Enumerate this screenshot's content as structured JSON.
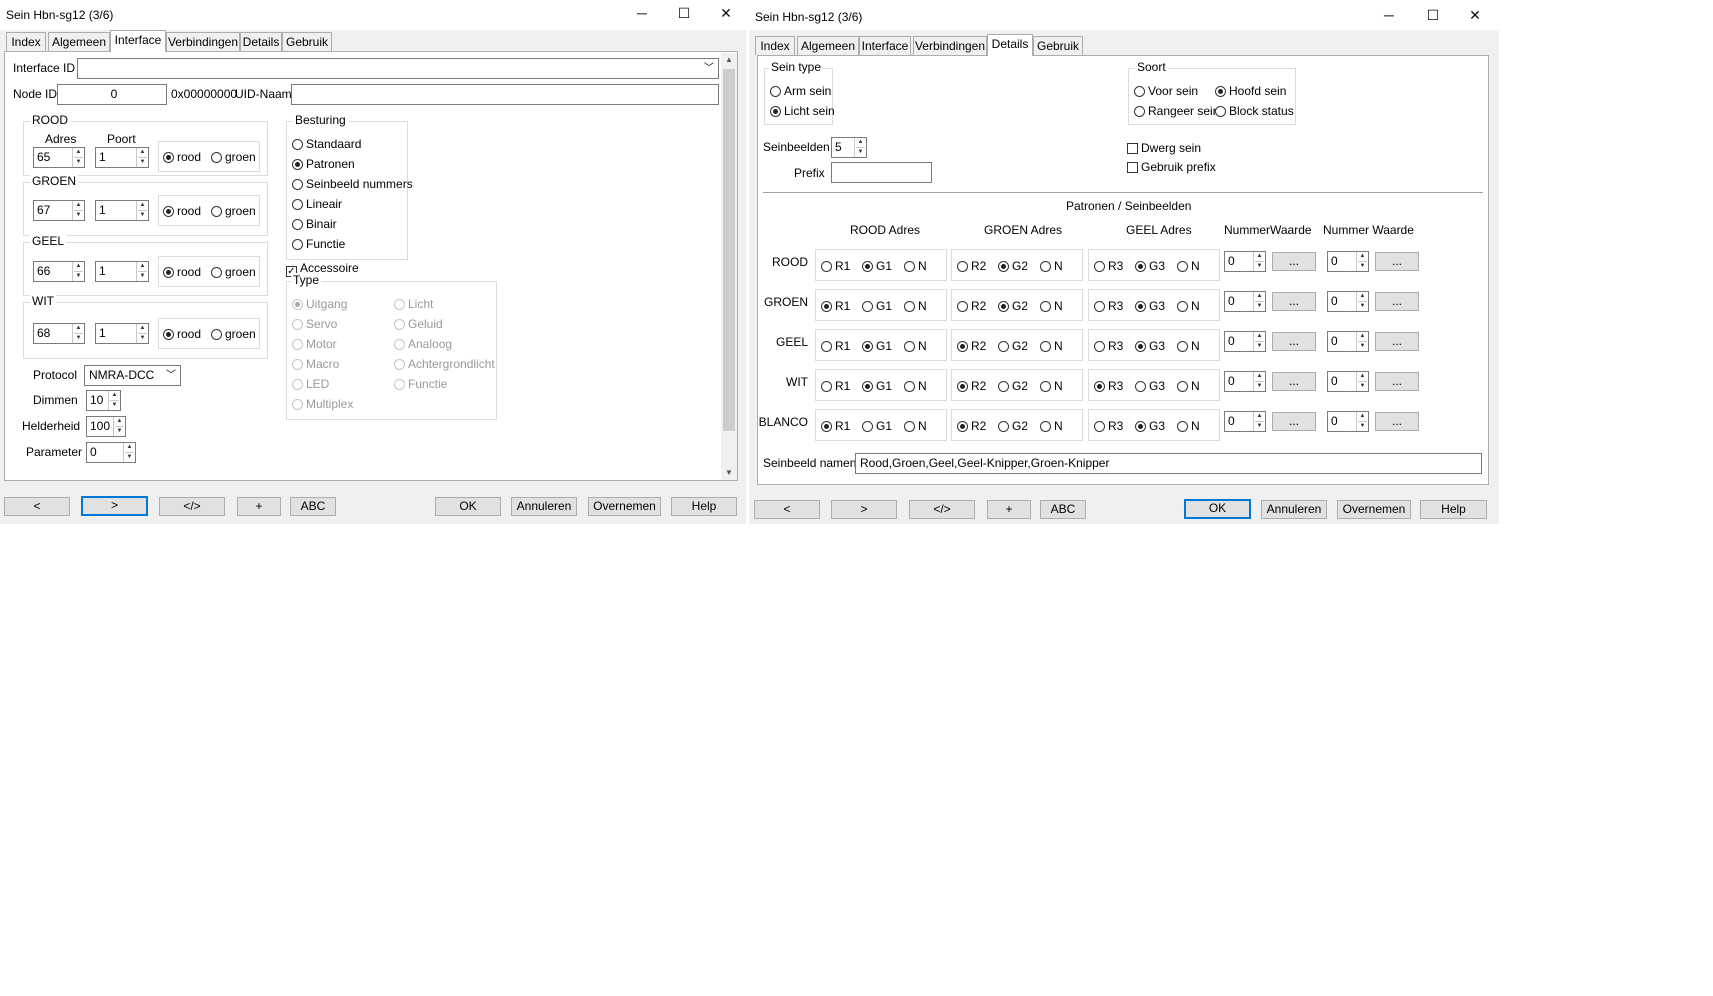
{
  "left": {
    "title": "Sein Hbn-sg12 (3/6)",
    "tabs": [
      "Index",
      "Algemeen",
      "Interface",
      "Verbindingen",
      "Details",
      "Gebruik"
    ],
    "interface_id_label": "Interface ID",
    "interface_id_value": "",
    "node_id_label": "Node ID",
    "node_id_value": "0",
    "hex_value": "0x00000000",
    "uid_label": "UID-Naam",
    "uid_value": "",
    "adres_label": "Adres",
    "poort_label": "Poort",
    "rood_option": "rood",
    "groen_option": "groen",
    "colors": [
      {
        "name": "ROOD",
        "adres": "65",
        "poort": "1"
      },
      {
        "name": "GROEN",
        "adres": "67",
        "poort": "1"
      },
      {
        "name": "GEEL",
        "adres": "66",
        "poort": "1"
      },
      {
        "name": "WIT",
        "adres": "68",
        "poort": "1"
      }
    ],
    "besturing_title": "Besturing",
    "besturing": [
      "Standaard",
      "Patronen",
      "Seinbeeld nummers",
      "Lineair",
      "Binair",
      "Functie"
    ],
    "besturing_selected": "Patronen",
    "accessoire_label": "Accessoire",
    "accessoire_checked": true,
    "type_title": "Type",
    "type_col1": [
      "Uitgang",
      "Servo",
      "Motor",
      "Macro",
      "LED",
      "Multiplex"
    ],
    "type_col2": [
      "Licht",
      "Geluid",
      "Analoog",
      "Achtergrondlicht",
      "Functie"
    ],
    "type_selected": "Uitgang",
    "protocol_label": "Protocol",
    "protocol_value": "NMRA-DCC",
    "dimmen_label": "Dimmen",
    "dimmen_value": "10",
    "helderheid_label": "Helderheid",
    "helderheid_value": "100",
    "parameter_label": "Parameter",
    "parameter_value": "0",
    "buttons": [
      "<",
      ">",
      "</>",
      "+",
      "ABC"
    ],
    "right_buttons": [
      "OK",
      "Annuleren",
      "Overnemen",
      "Help"
    ]
  },
  "right": {
    "title": "Sein Hbn-sg12 (3/6)",
    "tabs": [
      "Index",
      "Algemeen",
      "Interface",
      "Verbindingen",
      "Details",
      "Gebruik"
    ],
    "sein_type_title": "Sein type",
    "sein_type": [
      "Arm sein",
      "Licht sein"
    ],
    "sein_type_selected": "Licht sein",
    "soort_title": "Soort",
    "soort": [
      "Voor sein",
      "Hoofd sein",
      "Rangeer sein",
      "Block status"
    ],
    "soort_selected": "Hoofd sein",
    "seinbeelden_label": "Seinbeelden",
    "seinbeelden_value": "5",
    "prefix_label": "Prefix",
    "prefix_value": "",
    "dwerg_label": "Dwerg sein",
    "gebruik_prefix_label": "Gebruik prefix",
    "patronen_title": "Patronen / Seinbeelden",
    "col_headers": [
      "ROOD Adres",
      "GROEN Adres",
      "GEEL Adres",
      "NummerWaarde",
      "Nummer Waarde"
    ],
    "ellipsis": "...",
    "rows": [
      {
        "name": "ROOD",
        "g1": [
          "R1",
          "G1",
          "N"
        ],
        "s1": 1,
        "g2": [
          "R2",
          "G2",
          "N"
        ],
        "s2": 1,
        "g3": [
          "R3",
          "G3",
          "N"
        ],
        "s3": 1,
        "nw1": "0",
        "nw2": "0"
      },
      {
        "name": "GROEN",
        "g1": [
          "R1",
          "G1",
          "N"
        ],
        "s1": 0,
        "g2": [
          "R2",
          "G2",
          "N"
        ],
        "s2": 1,
        "g3": [
          "R3",
          "G3",
          "N"
        ],
        "s3": 1,
        "nw1": "0",
        "nw2": "0"
      },
      {
        "name": "GEEL",
        "g1": [
          "R1",
          "G1",
          "N"
        ],
        "s1": 1,
        "g2": [
          "R2",
          "G2",
          "N"
        ],
        "s2": 0,
        "g3": [
          "R3",
          "G3",
          "N"
        ],
        "s3": 1,
        "nw1": "0",
        "nw2": "0"
      },
      {
        "name": "WIT",
        "g1": [
          "R1",
          "G1",
          "N"
        ],
        "s1": 1,
        "g2": [
          "R2",
          "G2",
          "N"
        ],
        "s2": 0,
        "g3": [
          "R3",
          "G3",
          "N"
        ],
        "s3": 0,
        "nw1": "0",
        "nw2": "0"
      },
      {
        "name": "BLANCO",
        "g1": [
          "R1",
          "G1",
          "N"
        ],
        "s1": 0,
        "g2": [
          "R2",
          "G2",
          "N"
        ],
        "s2": 0,
        "g3": [
          "R3",
          "G3",
          "N"
        ],
        "s3": 1,
        "nw1": "0",
        "nw2": "0"
      }
    ],
    "seinbeeld_namen_label": "Seinbeeld namen",
    "seinbeeld_namen_value": "Rood,Groen,Geel,Geel-Knipper,Groen-Knipper",
    "buttons": [
      "<",
      ">",
      "</>",
      "+",
      "ABC"
    ],
    "right_buttons": [
      "OK",
      "Annuleren",
      "Overnemen",
      "Help"
    ]
  },
  "icons": {
    "minimize": "minimize-icon",
    "maximize": "maximize-icon",
    "close": "close-icon"
  }
}
